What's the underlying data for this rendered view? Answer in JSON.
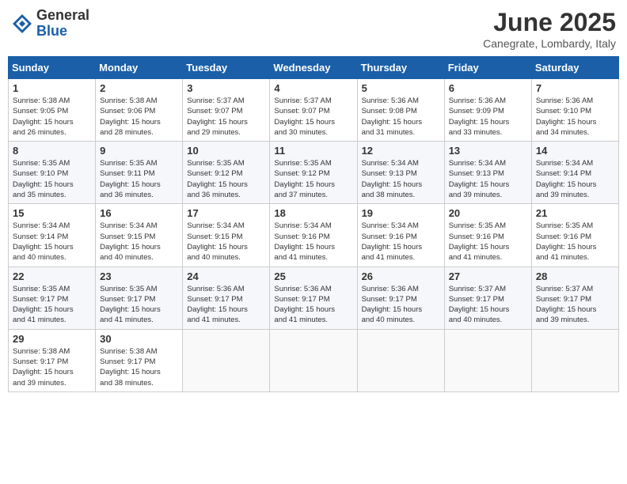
{
  "logo": {
    "general": "General",
    "blue": "Blue"
  },
  "title": {
    "month_year": "June 2025",
    "location": "Canegrate, Lombardy, Italy"
  },
  "days_of_week": [
    "Sunday",
    "Monday",
    "Tuesday",
    "Wednesday",
    "Thursday",
    "Friday",
    "Saturday"
  ],
  "weeks": [
    [
      {
        "day": "1",
        "info": "Sunrise: 5:38 AM\nSunset: 9:05 PM\nDaylight: 15 hours\nand 26 minutes."
      },
      {
        "day": "2",
        "info": "Sunrise: 5:38 AM\nSunset: 9:06 PM\nDaylight: 15 hours\nand 28 minutes."
      },
      {
        "day": "3",
        "info": "Sunrise: 5:37 AM\nSunset: 9:07 PM\nDaylight: 15 hours\nand 29 minutes."
      },
      {
        "day": "4",
        "info": "Sunrise: 5:37 AM\nSunset: 9:07 PM\nDaylight: 15 hours\nand 30 minutes."
      },
      {
        "day": "5",
        "info": "Sunrise: 5:36 AM\nSunset: 9:08 PM\nDaylight: 15 hours\nand 31 minutes."
      },
      {
        "day": "6",
        "info": "Sunrise: 5:36 AM\nSunset: 9:09 PM\nDaylight: 15 hours\nand 33 minutes."
      },
      {
        "day": "7",
        "info": "Sunrise: 5:36 AM\nSunset: 9:10 PM\nDaylight: 15 hours\nand 34 minutes."
      }
    ],
    [
      {
        "day": "8",
        "info": "Sunrise: 5:35 AM\nSunset: 9:10 PM\nDaylight: 15 hours\nand 35 minutes."
      },
      {
        "day": "9",
        "info": "Sunrise: 5:35 AM\nSunset: 9:11 PM\nDaylight: 15 hours\nand 36 minutes."
      },
      {
        "day": "10",
        "info": "Sunrise: 5:35 AM\nSunset: 9:12 PM\nDaylight: 15 hours\nand 36 minutes."
      },
      {
        "day": "11",
        "info": "Sunrise: 5:35 AM\nSunset: 9:12 PM\nDaylight: 15 hours\nand 37 minutes."
      },
      {
        "day": "12",
        "info": "Sunrise: 5:34 AM\nSunset: 9:13 PM\nDaylight: 15 hours\nand 38 minutes."
      },
      {
        "day": "13",
        "info": "Sunrise: 5:34 AM\nSunset: 9:13 PM\nDaylight: 15 hours\nand 39 minutes."
      },
      {
        "day": "14",
        "info": "Sunrise: 5:34 AM\nSunset: 9:14 PM\nDaylight: 15 hours\nand 39 minutes."
      }
    ],
    [
      {
        "day": "15",
        "info": "Sunrise: 5:34 AM\nSunset: 9:14 PM\nDaylight: 15 hours\nand 40 minutes."
      },
      {
        "day": "16",
        "info": "Sunrise: 5:34 AM\nSunset: 9:15 PM\nDaylight: 15 hours\nand 40 minutes."
      },
      {
        "day": "17",
        "info": "Sunrise: 5:34 AM\nSunset: 9:15 PM\nDaylight: 15 hours\nand 40 minutes."
      },
      {
        "day": "18",
        "info": "Sunrise: 5:34 AM\nSunset: 9:16 PM\nDaylight: 15 hours\nand 41 minutes."
      },
      {
        "day": "19",
        "info": "Sunrise: 5:34 AM\nSunset: 9:16 PM\nDaylight: 15 hours\nand 41 minutes."
      },
      {
        "day": "20",
        "info": "Sunrise: 5:35 AM\nSunset: 9:16 PM\nDaylight: 15 hours\nand 41 minutes."
      },
      {
        "day": "21",
        "info": "Sunrise: 5:35 AM\nSunset: 9:16 PM\nDaylight: 15 hours\nand 41 minutes."
      }
    ],
    [
      {
        "day": "22",
        "info": "Sunrise: 5:35 AM\nSunset: 9:17 PM\nDaylight: 15 hours\nand 41 minutes."
      },
      {
        "day": "23",
        "info": "Sunrise: 5:35 AM\nSunset: 9:17 PM\nDaylight: 15 hours\nand 41 minutes."
      },
      {
        "day": "24",
        "info": "Sunrise: 5:36 AM\nSunset: 9:17 PM\nDaylight: 15 hours\nand 41 minutes."
      },
      {
        "day": "25",
        "info": "Sunrise: 5:36 AM\nSunset: 9:17 PM\nDaylight: 15 hours\nand 41 minutes."
      },
      {
        "day": "26",
        "info": "Sunrise: 5:36 AM\nSunset: 9:17 PM\nDaylight: 15 hours\nand 40 minutes."
      },
      {
        "day": "27",
        "info": "Sunrise: 5:37 AM\nSunset: 9:17 PM\nDaylight: 15 hours\nand 40 minutes."
      },
      {
        "day": "28",
        "info": "Sunrise: 5:37 AM\nSunset: 9:17 PM\nDaylight: 15 hours\nand 39 minutes."
      }
    ],
    [
      {
        "day": "29",
        "info": "Sunrise: 5:38 AM\nSunset: 9:17 PM\nDaylight: 15 hours\nand 39 minutes."
      },
      {
        "day": "30",
        "info": "Sunrise: 5:38 AM\nSunset: 9:17 PM\nDaylight: 15 hours\nand 38 minutes."
      },
      {
        "day": "",
        "info": ""
      },
      {
        "day": "",
        "info": ""
      },
      {
        "day": "",
        "info": ""
      },
      {
        "day": "",
        "info": ""
      },
      {
        "day": "",
        "info": ""
      }
    ]
  ]
}
